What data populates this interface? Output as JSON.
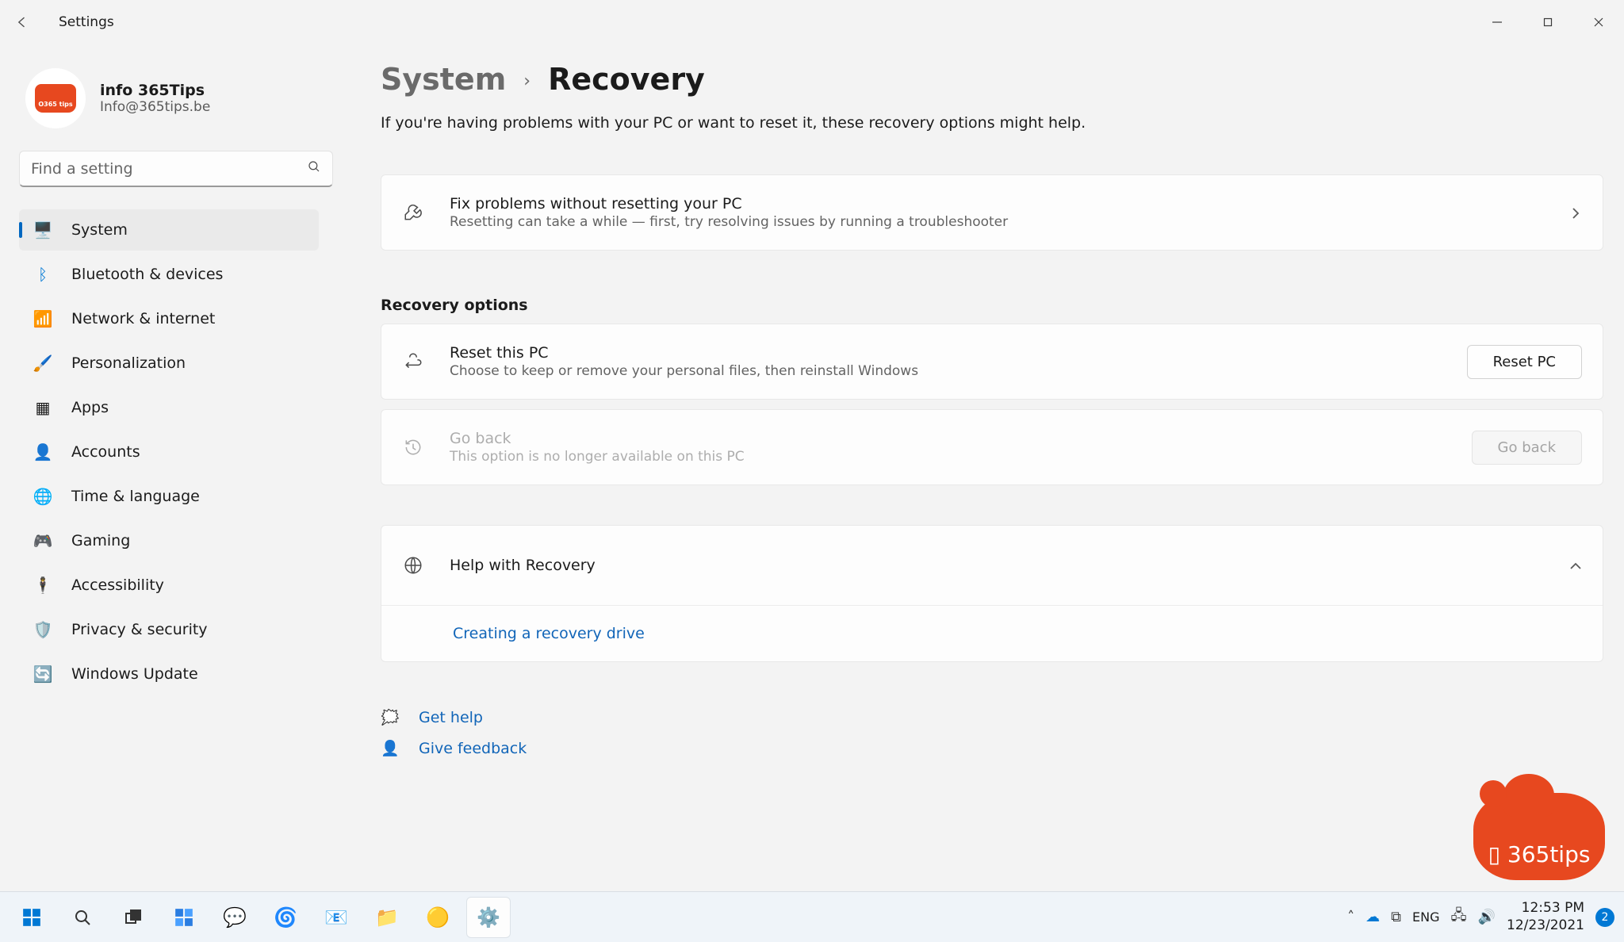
{
  "window": {
    "title": "Settings"
  },
  "user": {
    "name": "info 365Tips",
    "email": "Info@365tips.be"
  },
  "search": {
    "placeholder": "Find a setting"
  },
  "nav": {
    "items": [
      {
        "label": "System"
      },
      {
        "label": "Bluetooth & devices"
      },
      {
        "label": "Network & internet"
      },
      {
        "label": "Personalization"
      },
      {
        "label": "Apps"
      },
      {
        "label": "Accounts"
      },
      {
        "label": "Time & language"
      },
      {
        "label": "Gaming"
      },
      {
        "label": "Accessibility"
      },
      {
        "label": "Privacy & security"
      },
      {
        "label": "Windows Update"
      }
    ]
  },
  "breadcrumb": {
    "parent": "System",
    "current": "Recovery"
  },
  "intro": "If you're having problems with your PC or want to reset it, these recovery options might help.",
  "fixcard": {
    "title": "Fix problems without resetting your PC",
    "sub": "Resetting can take a while — first, try resolving issues by running a troubleshooter"
  },
  "section_recovery": "Recovery options",
  "reset": {
    "title": "Reset this PC",
    "sub": "Choose to keep or remove your personal files, then reinstall Windows",
    "action": "Reset PC"
  },
  "goback": {
    "title": "Go back",
    "sub": "This option is no longer available on this PC",
    "action": "Go back"
  },
  "help_panel": {
    "title": "Help with Recovery",
    "link": "Creating a recovery drive"
  },
  "footer": {
    "get_help": "Get help",
    "give_feedback": "Give feedback"
  },
  "watermark": "365tips",
  "taskbar": {
    "lang": "ENG",
    "time": "12:53 PM",
    "date": "12/23/2021",
    "notif_count": "2"
  }
}
